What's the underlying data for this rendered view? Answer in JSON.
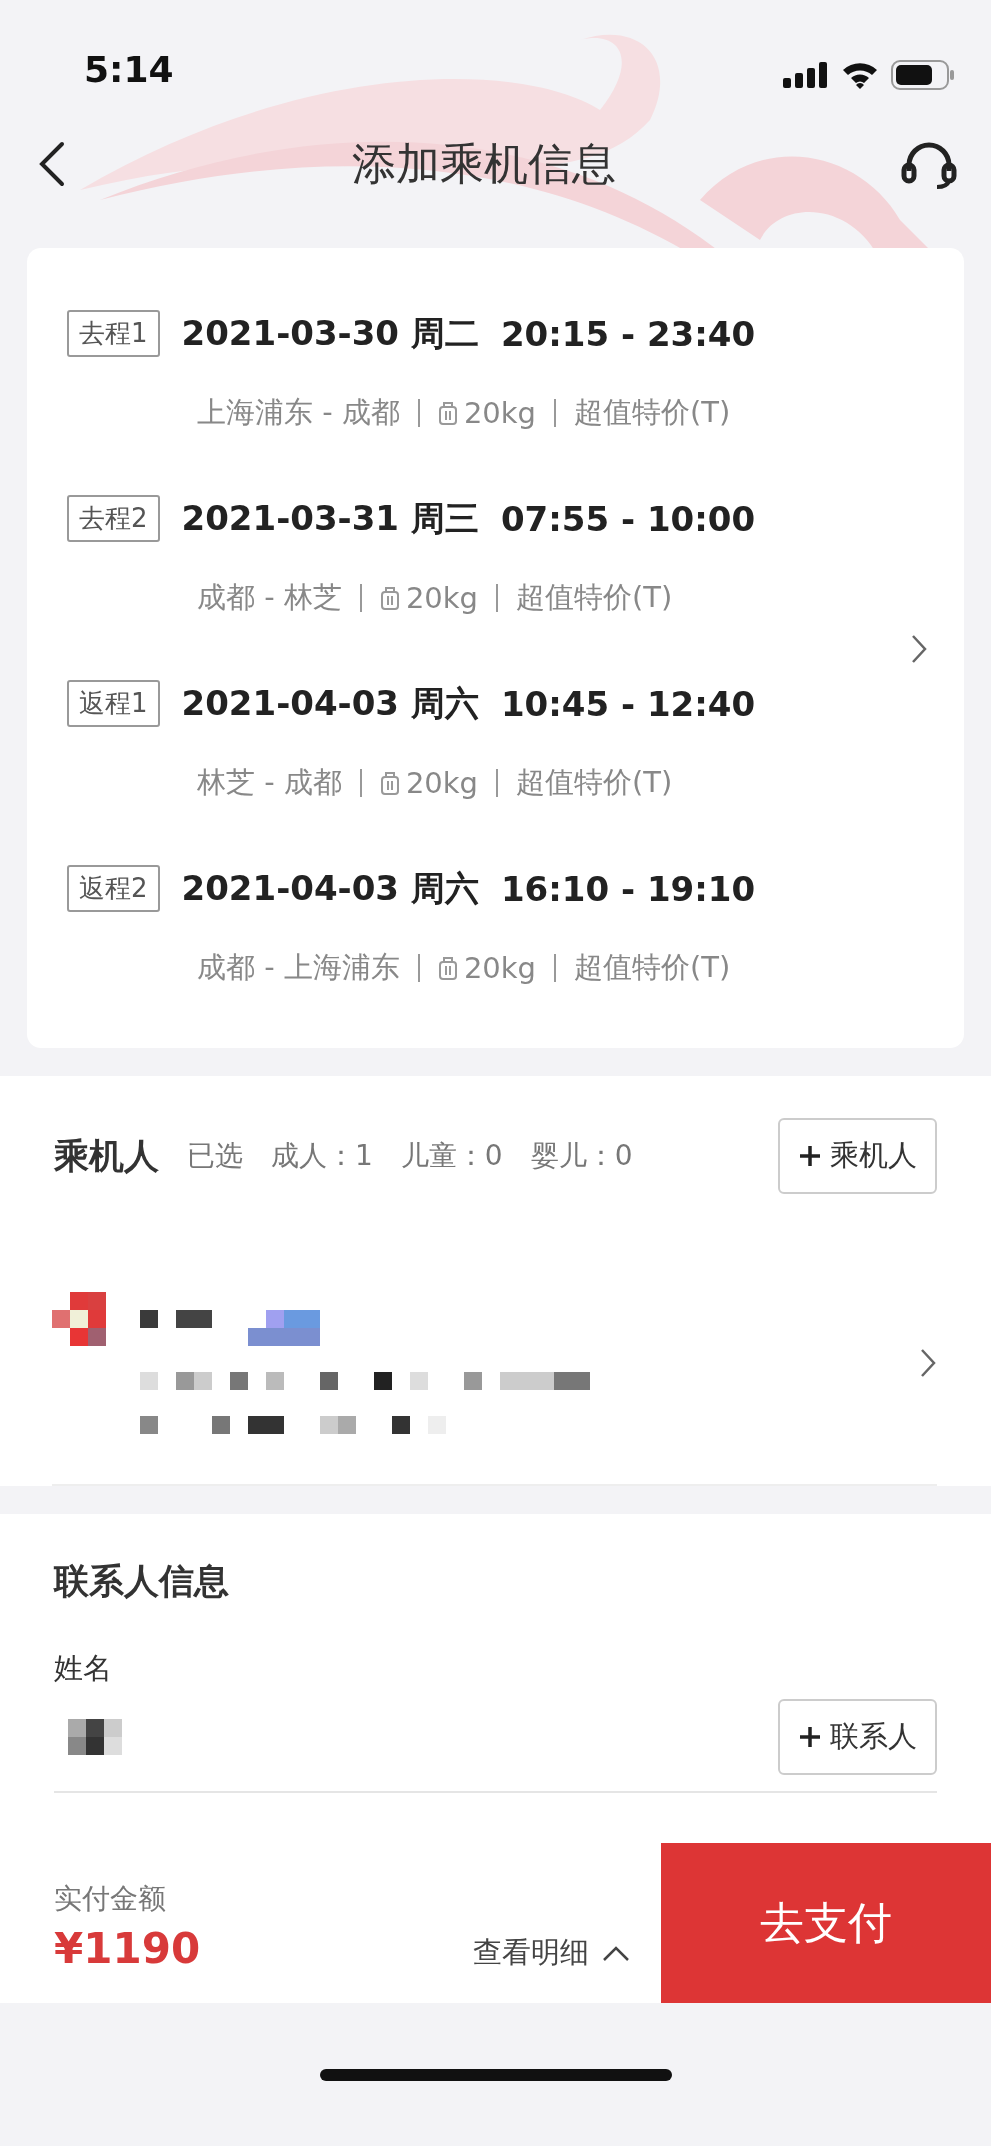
{
  "status_bar": {
    "time": "5:14"
  },
  "header": {
    "title": "添加乘机信息"
  },
  "flights": [
    {
      "tag": "去程1",
      "date": "2021-03-30 周二",
      "time": "20:15 - 23:40",
      "route": "上海浦东 - 成都",
      "baggage": "20kg",
      "fare": "超值特价(T)"
    },
    {
      "tag": "去程2",
      "date": "2021-03-31 周三",
      "time": "07:55 - 10:00",
      "route": "成都 - 林芝",
      "baggage": "20kg",
      "fare": "超值特价(T)"
    },
    {
      "tag": "返程1",
      "date": "2021-04-03 周六",
      "time": "10:45 - 12:40",
      "route": "林芝 - 成都",
      "baggage": "20kg",
      "fare": "超值特价(T)"
    },
    {
      "tag": "返程2",
      "date": "2021-04-03 周六",
      "time": "16:10 - 19:10",
      "route": "成都 - 上海浦东",
      "baggage": "20kg",
      "fare": "超值特价(T)"
    }
  ],
  "passengers": {
    "title": "乘机人",
    "selected_label": "已选",
    "counts": [
      "成人：1",
      "儿童：0",
      "婴儿：0"
    ],
    "add_button": "乘机人"
  },
  "contact": {
    "title": "联系人信息",
    "name_label": "姓名",
    "add_button": "联系人"
  },
  "footer": {
    "label": "实付金额",
    "amount": "¥1190",
    "details": "查看明细",
    "pay_button": "去支付"
  }
}
